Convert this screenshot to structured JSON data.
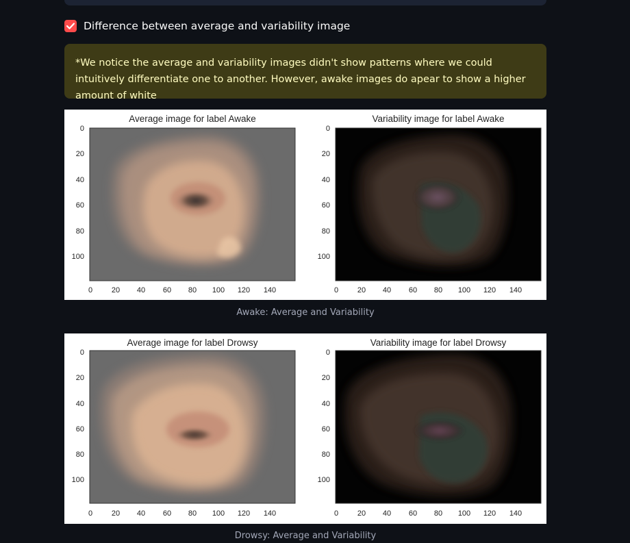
{
  "checkbox": {
    "label": "Difference between average and variability image",
    "checked": true
  },
  "note": {
    "text": "*We notice the average and variability images didn't show patterns where we could intuitively differentiate one to another. However, awake images do apear to show a higher amount of white"
  },
  "figures": [
    {
      "caption": "Awake: Average and Variability",
      "panels": [
        {
          "title": "Average image for label Awake"
        },
        {
          "title": "Variability image for label Awake"
        }
      ]
    },
    {
      "caption": "Drowsy: Average and Variability",
      "panels": [
        {
          "title": "Average image for label Drowsy"
        },
        {
          "title": "Variability image for label Drowsy"
        }
      ]
    }
  ],
  "axes": {
    "x_ticks": [
      "0",
      "20",
      "40",
      "60",
      "80",
      "100",
      "120",
      "140"
    ],
    "y_ticks": [
      "0",
      "20",
      "40",
      "60",
      "80",
      "100"
    ],
    "x_values": [
      0,
      20,
      40,
      60,
      80,
      100,
      120,
      140
    ],
    "y_values": [
      0,
      20,
      40,
      60,
      80,
      100
    ],
    "xlim": [
      -0.5,
      159.5
    ],
    "ylim": [
      119.5,
      -0.5
    ]
  },
  "colors": {
    "average_bg": "#6b6b6b",
    "variability_bg": "#030303",
    "skin": "#d5ad8f",
    "accent": "#ff4b4b"
  }
}
